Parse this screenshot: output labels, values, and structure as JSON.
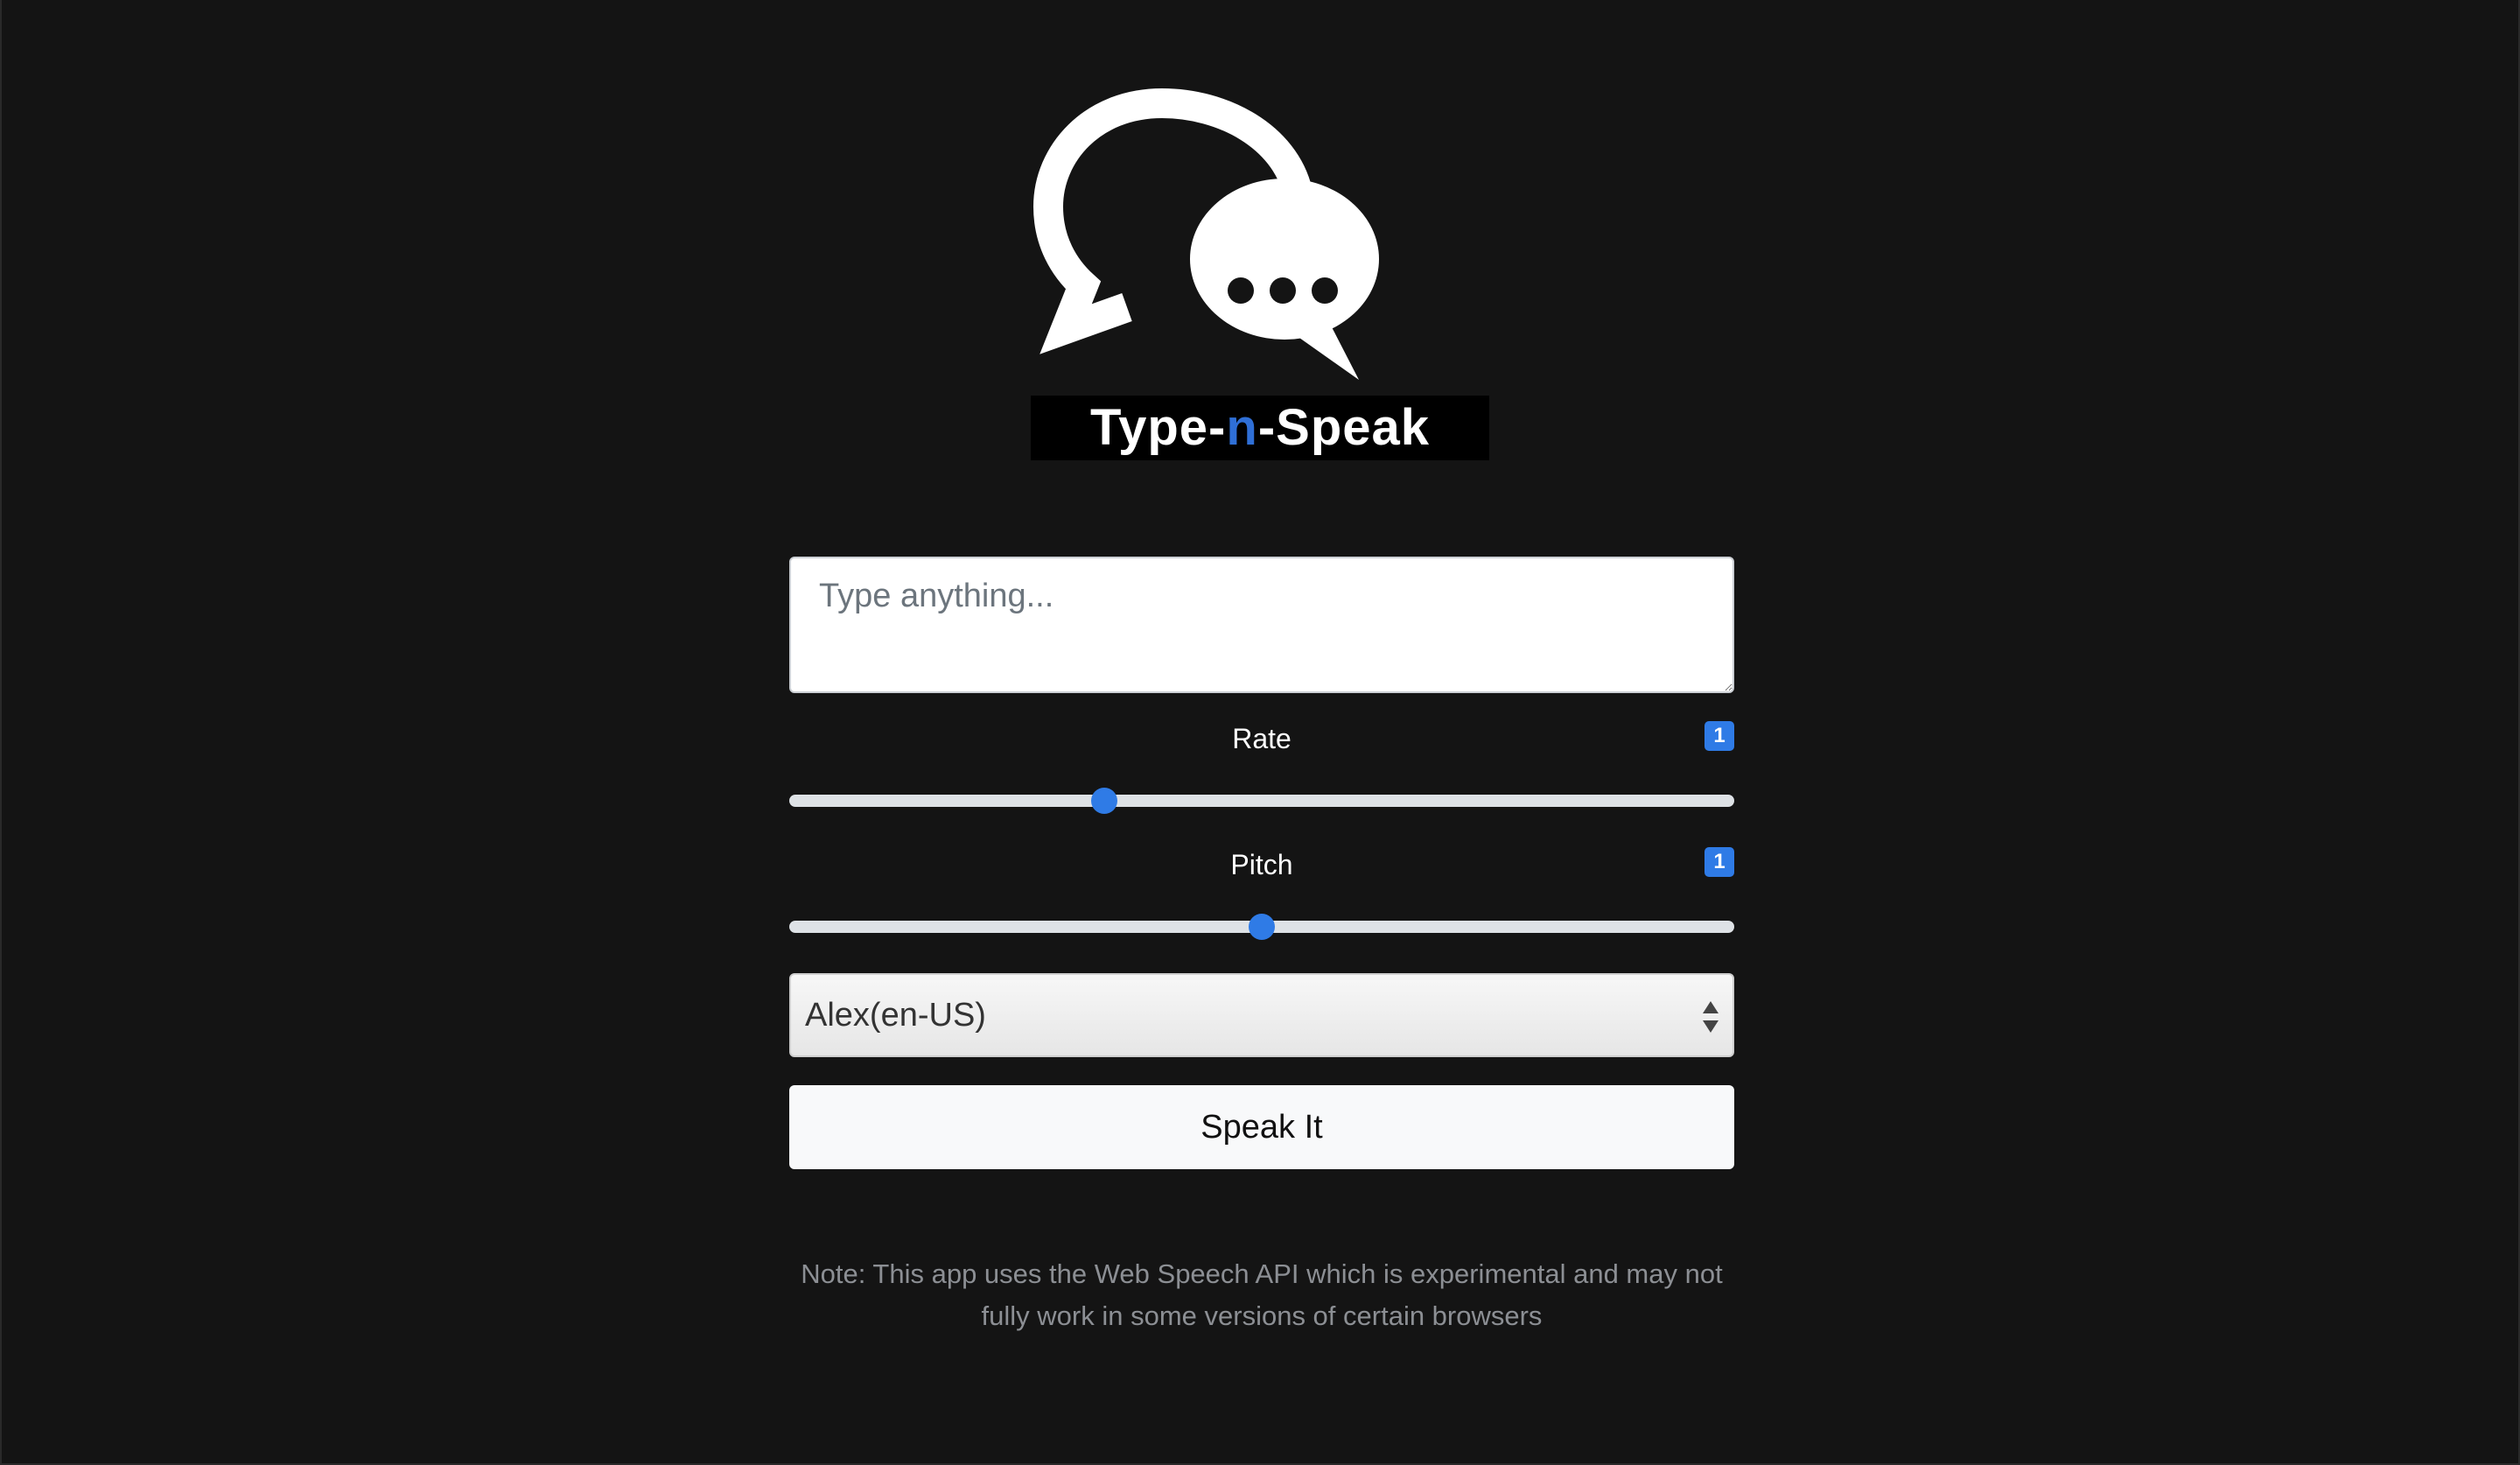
{
  "logo": {
    "title_part1": "Type-",
    "title_accent": "n",
    "title_part2": "-Speak",
    "icon": "chat-bubbles-icon"
  },
  "text_input": {
    "placeholder": "Type anything...",
    "value": ""
  },
  "rate": {
    "label": "Rate",
    "value": "1",
    "min": 0.5,
    "max": 2,
    "current": 1
  },
  "pitch": {
    "label": "Pitch",
    "value": "1",
    "min": 0,
    "max": 2,
    "current": 1
  },
  "voice_select": {
    "selected": "Alex(en-US)"
  },
  "speak_button": {
    "label": "Speak It"
  },
  "note": {
    "text": "Note: This app uses the Web Speech API which is experimental and may not fully work in some versions of certain browsers"
  },
  "colors": {
    "background": "#141414",
    "accent": "#2f7be6"
  }
}
